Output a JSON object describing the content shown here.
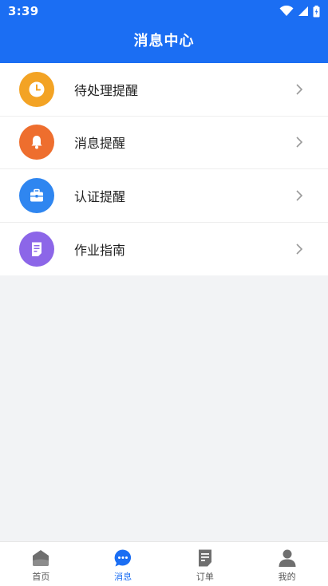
{
  "status_bar": {
    "time": "3:39"
  },
  "header": {
    "title": "消息中心"
  },
  "list": {
    "items": [
      {
        "label": "待处理提醒",
        "icon": "clock-icon",
        "color": "#f3a324"
      },
      {
        "label": "消息提醒",
        "icon": "bell-icon",
        "color": "#ee6e2e"
      },
      {
        "label": "认证提醒",
        "icon": "briefcase-icon",
        "color": "#2f86f0"
      },
      {
        "label": "作业指南",
        "icon": "document-icon",
        "color": "#8c66e8"
      }
    ]
  },
  "tabbar": {
    "tabs": [
      {
        "label": "首页",
        "icon": "home-icon",
        "active": false
      },
      {
        "label": "消息",
        "icon": "chat-bubble-icon",
        "active": true
      },
      {
        "label": "订单",
        "icon": "order-document-icon",
        "active": false
      },
      {
        "label": "我的",
        "icon": "user-icon",
        "active": false
      }
    ]
  },
  "colors": {
    "brand": "#1b6ef3",
    "inactive_tab": "#777777"
  }
}
